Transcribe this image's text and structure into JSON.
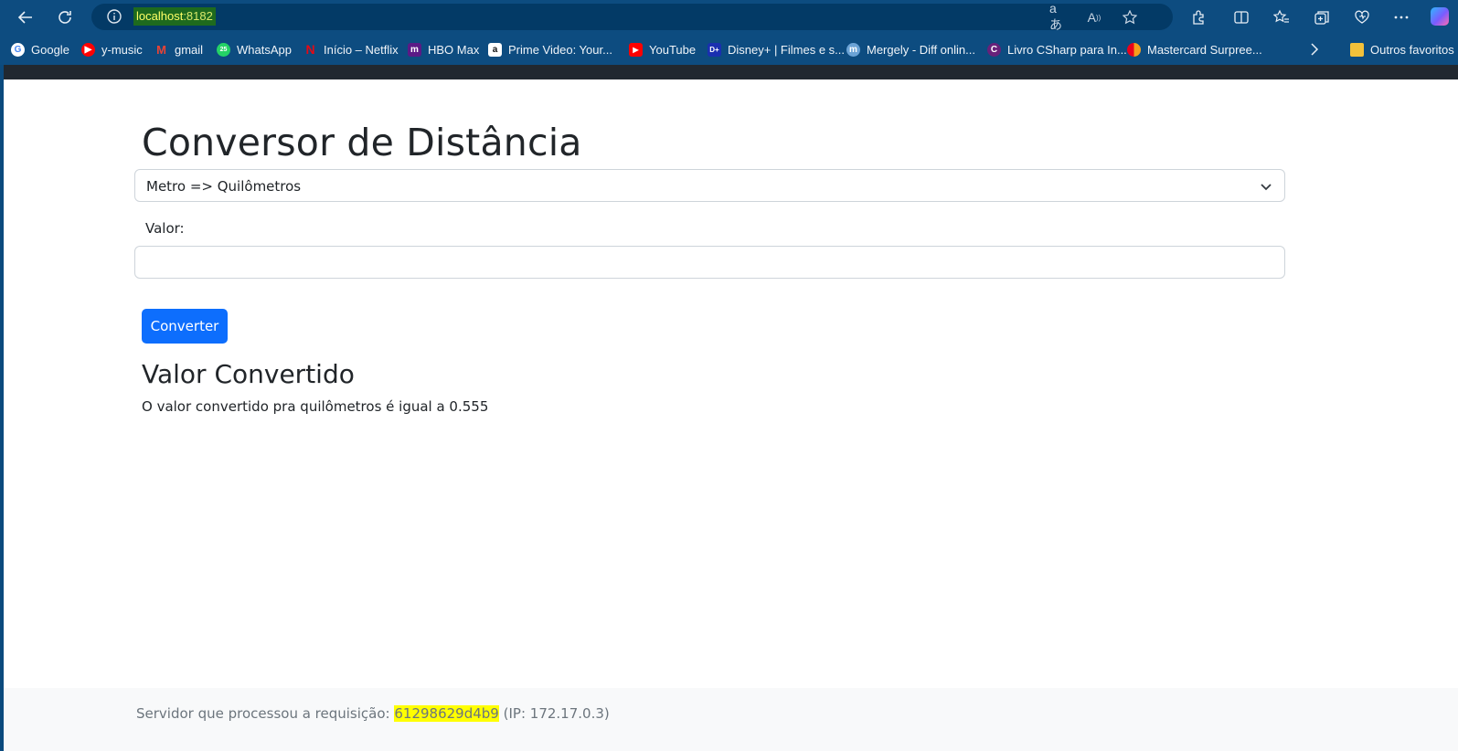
{
  "browser": {
    "url_host": "localhost",
    "url_port": ":8182",
    "bookmarks": [
      {
        "label": "Google",
        "icon": "google-icon",
        "color": "#ffffff"
      },
      {
        "label": "y-music",
        "icon": "youtube-music-icon",
        "color": "#ff0000"
      },
      {
        "label": "gmail",
        "icon": "gmail-icon",
        "color": "#ea4335"
      },
      {
        "label": "WhatsApp",
        "icon": "whatsapp-icon",
        "color": "#25d366"
      },
      {
        "label": "Início – Netflix",
        "icon": "netflix-icon",
        "color": "#e50914"
      },
      {
        "label": "HBO Max",
        "icon": "hbo-max-icon",
        "color": "#5b1a86"
      },
      {
        "label": "Prime Video: Your...",
        "icon": "amazon-icon",
        "color": "#ffffff"
      },
      {
        "label": "YouTube",
        "icon": "youtube-icon",
        "color": "#ff0000"
      },
      {
        "label": "Disney+ | Filmes e s...",
        "icon": "disney-plus-icon",
        "color": "#1a2fb0"
      },
      {
        "label": "Mergely - Diff onlin...",
        "icon": "mergely-icon",
        "color": "#6ba3d6"
      },
      {
        "label": "Livro CSharp para In...",
        "icon": "csharp-icon",
        "color": "#68217a"
      },
      {
        "label": "Mastercard Surpree...",
        "icon": "mastercard-icon",
        "color": "#eb001b"
      }
    ],
    "other_favorites": "Outros favoritos"
  },
  "page": {
    "title": "Conversor de Distância",
    "select_value": "Metro => Quilômetros",
    "value_label": "Valor:",
    "value_input": "",
    "convert_button": "Converter",
    "result_heading": "Valor Convertido",
    "result_text": "O valor convertido pra quilômetros é igual a 0.555"
  },
  "footer": {
    "prefix": "Servidor que processou a requisição:",
    "server_id": "61298629d4b9",
    "ip": "(IP: 172.17.0.3)"
  },
  "colors": {
    "chrome": "#0d4c80",
    "primary_button": "#0d6efd",
    "highlight": "#ffff00"
  }
}
